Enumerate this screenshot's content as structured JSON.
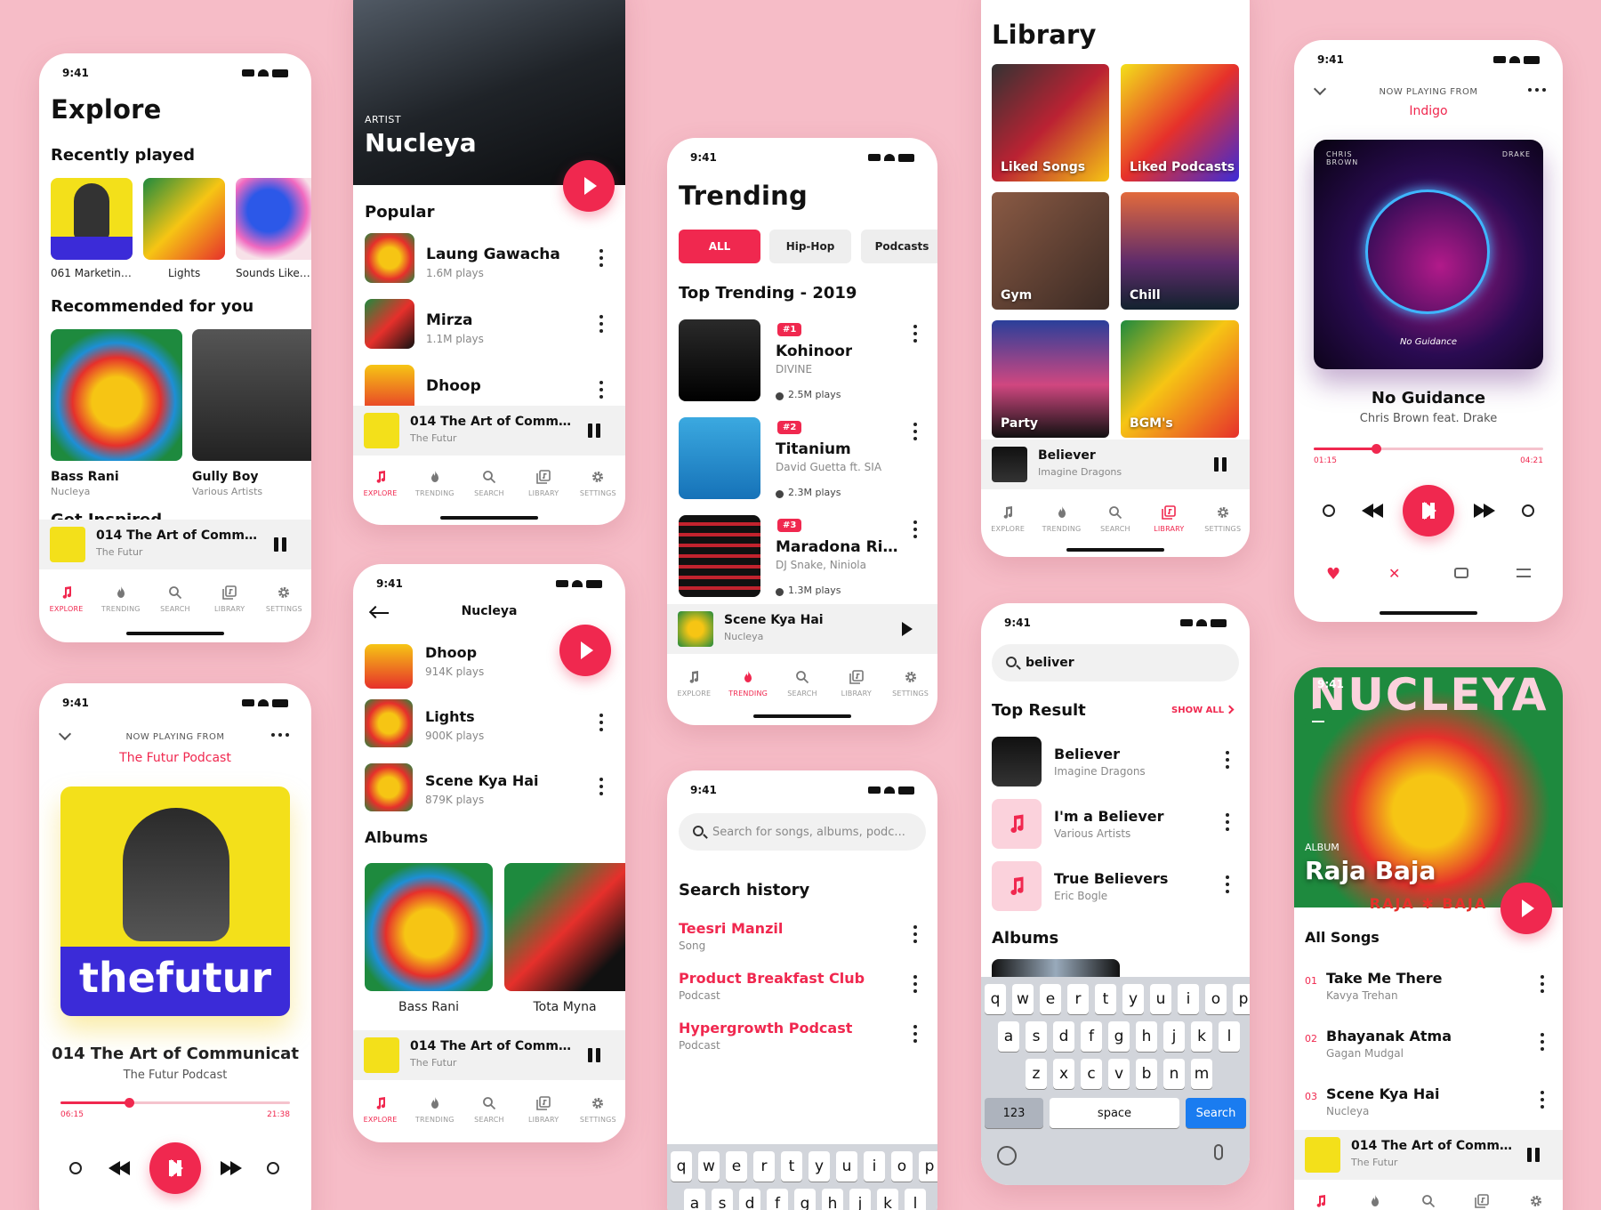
{
  "status_time": "9:41",
  "nav": [
    "EXPLORE",
    "TRENDING",
    "SEARCH",
    "LIBRARY",
    "SETTINGS"
  ],
  "colors": {
    "accent": "#f0284f",
    "background": "#f6bcc7"
  },
  "mini_player": {
    "title": "014 The Art of Communic...",
    "subtitle": "The Futur"
  },
  "explore": {
    "title": "Explore",
    "recently_played_title": "Recently played",
    "recent": [
      {
        "label": "061 Marketing..."
      },
      {
        "label": "Lights"
      },
      {
        "label": "Sounds Like G..."
      }
    ],
    "recommended_title": "Recommended for you",
    "recommended": [
      {
        "title": "Bass Rani",
        "sub": "Nucleya"
      },
      {
        "title": "Gully Boy",
        "sub": "Various Artists"
      }
    ],
    "get_inspired": "Get Inspired"
  },
  "artist": {
    "kicker": "ARTIST",
    "name": "Nucleya",
    "popular_title": "Popular",
    "popular": [
      {
        "title": "Laung Gawacha",
        "sub": "1.6M plays"
      },
      {
        "title": "Mirza",
        "sub": "1.1M plays"
      },
      {
        "title": "Dhoop",
        "sub": "914K plays"
      }
    ]
  },
  "artist_scrolled": {
    "header": "Nucleya",
    "songs": [
      {
        "title": "Dhoop",
        "sub": "914K plays"
      },
      {
        "title": "Lights",
        "sub": "900K plays"
      },
      {
        "title": "Scene Kya Hai",
        "sub": "879K plays"
      }
    ],
    "albums_title": "Albums",
    "albums": [
      {
        "title": "Bass Rani"
      },
      {
        "title": "Tota Myna"
      }
    ]
  },
  "now_playing_podcast": {
    "from_label": "NOW PLAYING FROM",
    "from": "The Futur Podcast",
    "art_text": "thefutur",
    "title": "014 The Art of Communicat",
    "sub": "The Futur Podcast",
    "elapsed": "06:15",
    "total": "21:38",
    "progress": 0.3
  },
  "trending": {
    "title": "Trending",
    "chips": [
      "ALL",
      "Hip-Hop",
      "Podcasts"
    ],
    "section": "Top Trending - 2019",
    "items": [
      {
        "rank": "#1",
        "title": "Kohinoor",
        "artist": "DIVINE",
        "plays": "2.5M plays"
      },
      {
        "rank": "#2",
        "title": "Titanium",
        "artist": "David Guetta ft. SIA",
        "plays": "2.3M plays"
      },
      {
        "rank": "#3",
        "title": "Maradona Rid...",
        "artist": "DJ Snake, Niniola",
        "plays": "1.3M plays"
      }
    ],
    "mini": {
      "title": "Scene Kya Hai",
      "subtitle": "Nucleya"
    }
  },
  "search_history": {
    "placeholder": "Search for songs, albums, podc...",
    "title": "Search history",
    "items": [
      {
        "title": "Teesri Manzil",
        "sub": "Song"
      },
      {
        "title": "Product Breakfast Club",
        "sub": "Podcast"
      },
      {
        "title": "Hypergrowth Podcast",
        "sub": "Podcast"
      }
    ]
  },
  "library": {
    "title": "Library",
    "tiles": [
      "Liked Songs",
      "Liked Podcasts",
      "Gym",
      "Chill",
      "Party",
      "BGM's"
    ],
    "mini": {
      "title": "Believer",
      "subtitle": "Imagine Dragons"
    }
  },
  "search_results": {
    "query": "beliver",
    "top_result": "Top Result",
    "show_all": "SHOW ALL",
    "results": [
      {
        "title": "Believer",
        "sub": "Imagine Dragons"
      },
      {
        "title": "I'm a Believer",
        "sub": "Various Artists"
      },
      {
        "title": "True Believers",
        "sub": "Eric Bogle"
      }
    ],
    "albums_title": "Albums",
    "keys_row1": [
      "q",
      "w",
      "e",
      "r",
      "t",
      "y",
      "u",
      "i",
      "o",
      "p"
    ],
    "keys_row2": [
      "a",
      "s",
      "d",
      "f",
      "g",
      "h",
      "j",
      "k",
      "l"
    ],
    "keys_row3": [
      "z",
      "x",
      "c",
      "v",
      "b",
      "n",
      "m"
    ],
    "key_123": "123",
    "key_space": "space",
    "key_search": "Search"
  },
  "now_playing_music": {
    "from_label": "NOW PLAYING FROM",
    "from": "Indigo",
    "art_text": "No Guidance",
    "art_left": "CHRIS BROWN",
    "art_right": "DRAKE",
    "title": "No Guidance",
    "sub": "Chris Brown feat. Drake",
    "elapsed": "01:15",
    "total": "04:21",
    "progress": 0.27
  },
  "album": {
    "kicker": "ALBUM",
    "name": "Raja Baja",
    "art_top": "NUCLEYA",
    "art_bottom": "RAJA ✱ BAJA",
    "all_songs": "All Songs",
    "songs": [
      {
        "n": "01",
        "title": "Take Me There",
        "sub": "Kavya Trehan"
      },
      {
        "n": "02",
        "title": "Bhayanak Atma",
        "sub": "Gagan Mudgal"
      },
      {
        "n": "03",
        "title": "Scene Kya Hai",
        "sub": "Nucleya"
      }
    ]
  }
}
